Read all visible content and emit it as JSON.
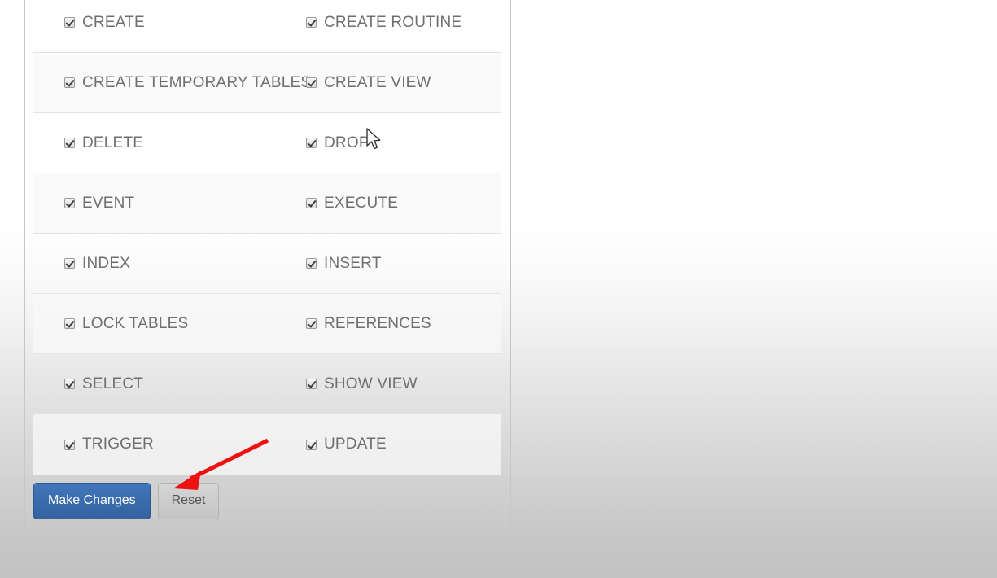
{
  "panel": {
    "name": "database-privileges-panel",
    "rows": [
      {
        "left": "CREATE",
        "right": "CREATE ROUTINE",
        "left_checked": true,
        "right_checked": true,
        "striped": false
      },
      {
        "left": "CREATE TEMPORARY TABLES",
        "right": "CREATE VIEW",
        "left_checked": true,
        "right_checked": true,
        "striped": true
      },
      {
        "left": "DELETE",
        "right": "DROP",
        "left_checked": true,
        "right_checked": true,
        "striped": false
      },
      {
        "left": "EVENT",
        "right": "EXECUTE",
        "left_checked": true,
        "right_checked": true,
        "striped": true
      },
      {
        "left": "INDEX",
        "right": "INSERT",
        "left_checked": true,
        "right_checked": true,
        "striped": false
      },
      {
        "left": "LOCK TABLES",
        "right": "REFERENCES",
        "left_checked": true,
        "right_checked": true,
        "striped": true
      },
      {
        "left": "SELECT",
        "right": "SHOW VIEW",
        "left_checked": true,
        "right_checked": true,
        "striped": false
      },
      {
        "left": "TRIGGER",
        "right": "UPDATE",
        "left_checked": true,
        "right_checked": true,
        "striped": true
      }
    ]
  },
  "actions": {
    "make_changes_label": "Make Changes",
    "reset_label": "Reset"
  },
  "colors": {
    "primary_button": "#3a6eb5",
    "secondary_button": "#c9c9c9",
    "annotation_arrow": "#ee1111",
    "label_text": "#6f6f6f",
    "page_background_bottom": "#c2c2c2"
  }
}
